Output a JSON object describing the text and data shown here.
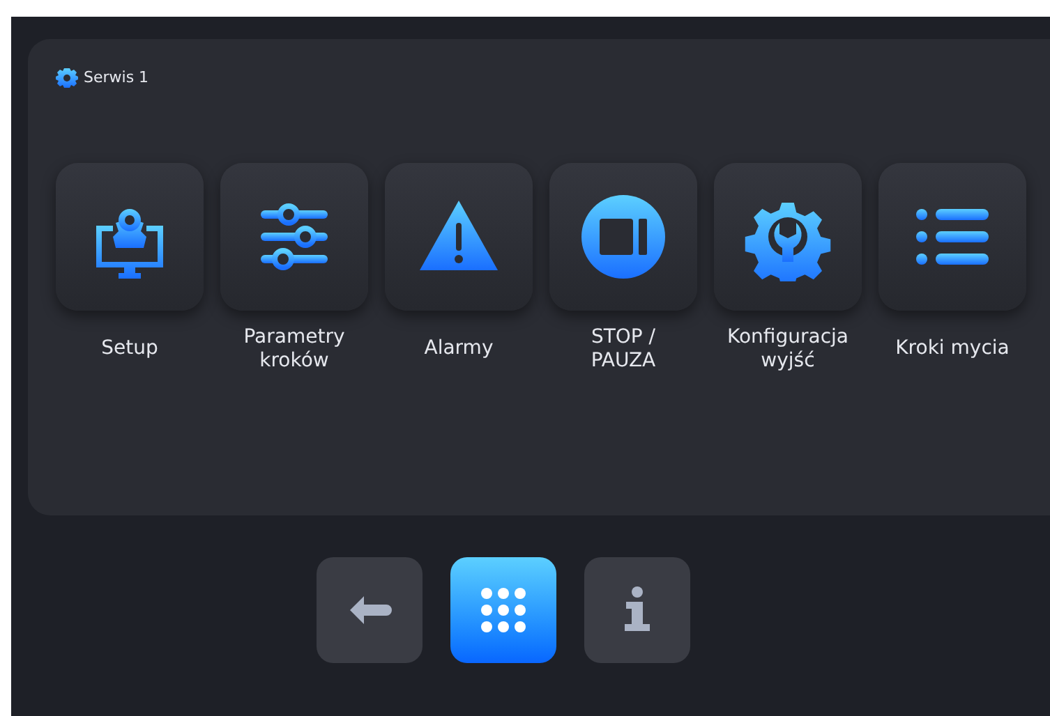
{
  "panel": {
    "title": "Serwis 1"
  },
  "tiles": [
    {
      "label": "Setup",
      "kind": "setup"
    },
    {
      "label": "Parametry\nkroków",
      "kind": "sliders"
    },
    {
      "label": "Alarmy",
      "kind": "alarm"
    },
    {
      "label": "STOP /\nPAUZA",
      "kind": "stop"
    },
    {
      "label": "Konfiguracja\nwyjść",
      "kind": "config"
    },
    {
      "label": "Kroki mycia",
      "kind": "list"
    }
  ],
  "nav": [
    {
      "kind": "back",
      "selected": false
    },
    {
      "kind": "menu",
      "selected": true
    },
    {
      "kind": "info",
      "selected": false
    }
  ]
}
